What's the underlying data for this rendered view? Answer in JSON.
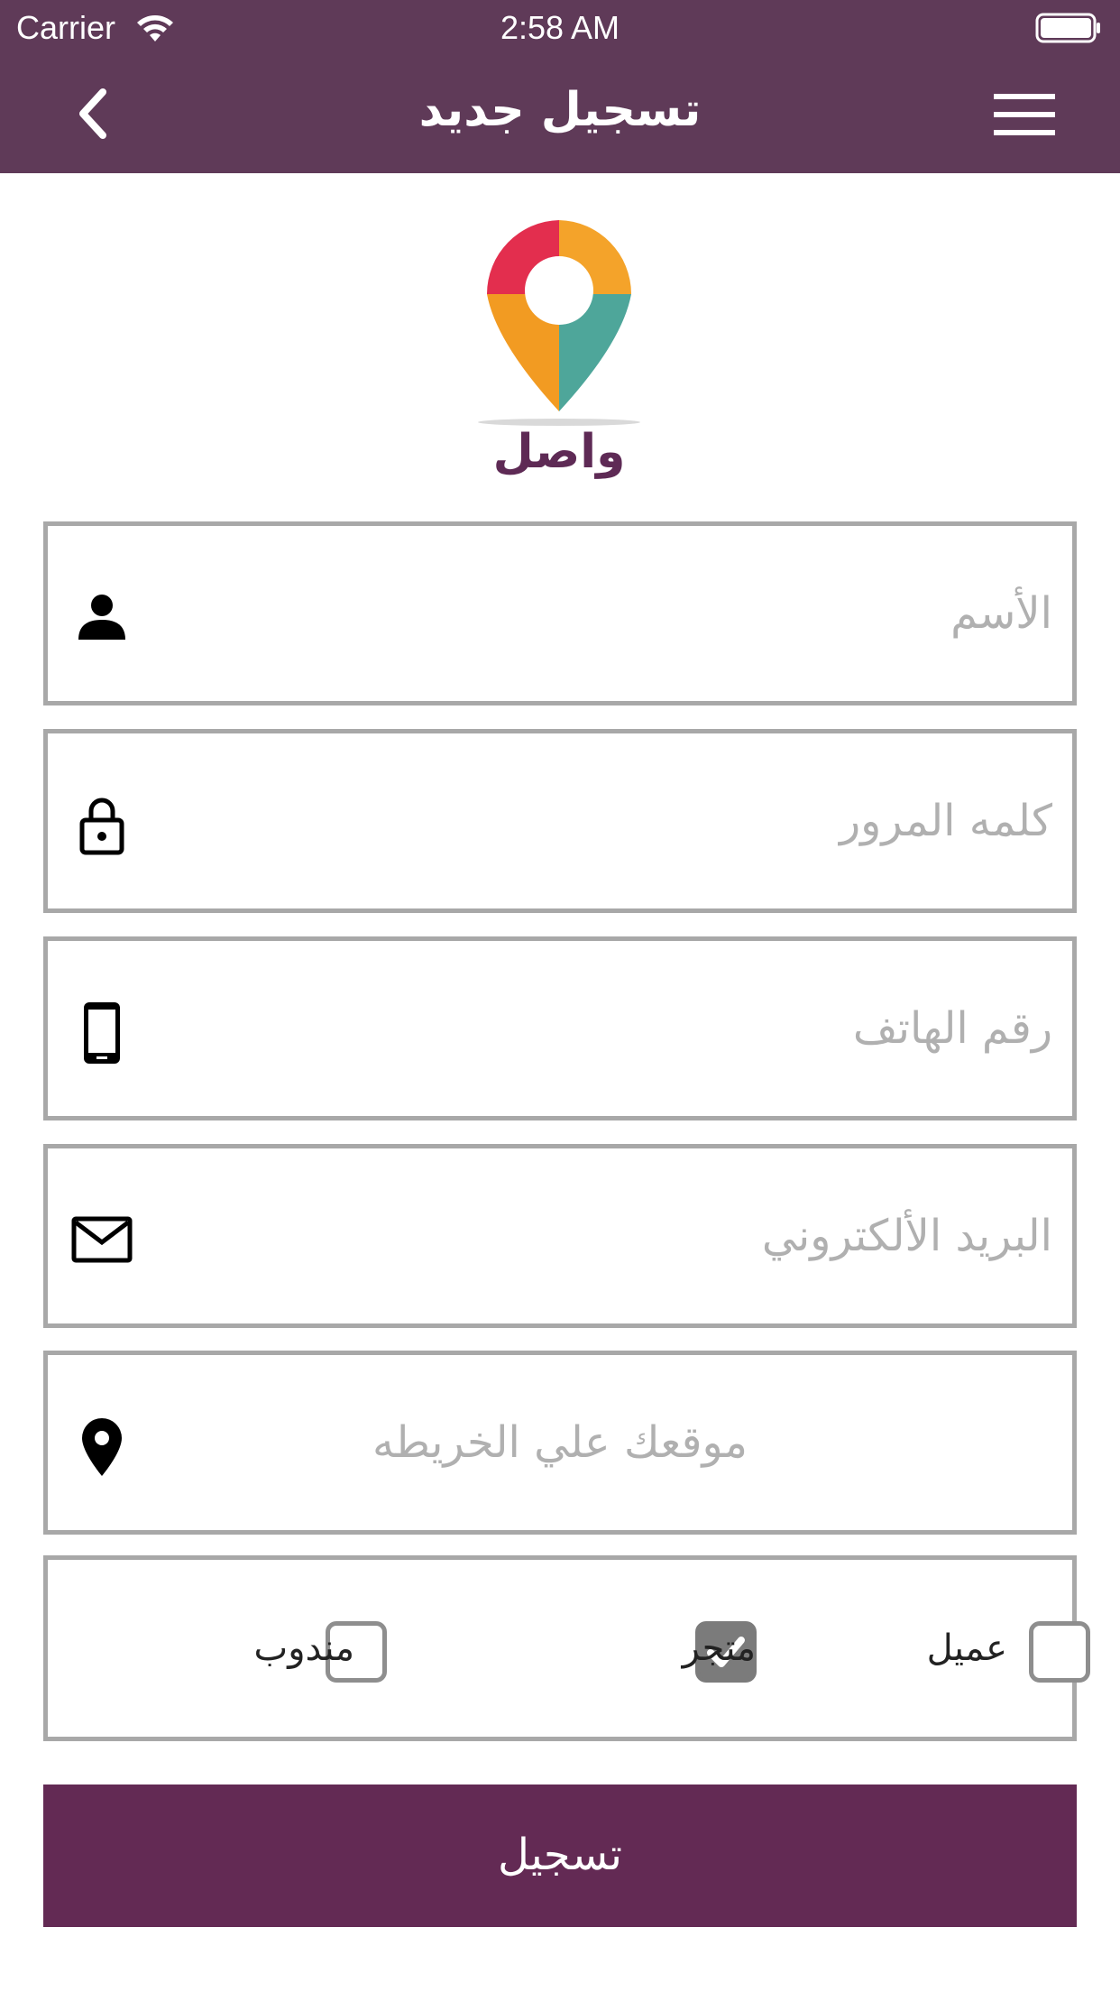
{
  "status_bar": {
    "carrier": "Carrier",
    "time": "2:58 AM"
  },
  "nav": {
    "title": "تسجيل جديد",
    "back_icon": "chevron-left-icon",
    "menu_icon": "hamburger-menu-icon"
  },
  "logo": {
    "text": "واصل",
    "icon": "map-pin-logo"
  },
  "form": {
    "name": {
      "placeholder": "الأسم",
      "icon": "person-icon"
    },
    "password": {
      "placeholder": "كلمه المرور",
      "icon": "lock-icon"
    },
    "phone": {
      "placeholder": "رقم الهاتف",
      "icon": "phone-icon"
    },
    "email": {
      "placeholder": "البريد الألكتروني",
      "icon": "mail-icon"
    },
    "location": {
      "placeholder": "موقعك علي الخريطه",
      "icon": "location-pin-icon"
    }
  },
  "roles": [
    {
      "label": "عميل",
      "checked": false
    },
    {
      "label": "متجر",
      "checked": true
    },
    {
      "label": "مندوب",
      "checked": false
    }
  ],
  "submit_label": "تسجيل",
  "colors": {
    "primary": "#5f3a58",
    "button": "#632a54",
    "field_border": "#a8a8a8",
    "placeholder": "#b0b0b0"
  }
}
